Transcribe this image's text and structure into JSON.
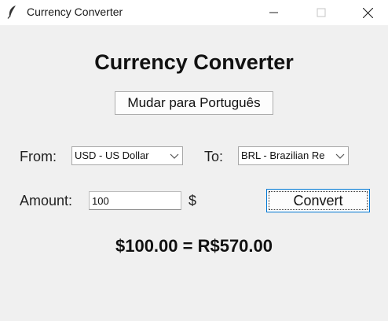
{
  "window": {
    "title": "Currency Converter",
    "icon": "feather-icon"
  },
  "main": {
    "heading": "Currency Converter",
    "language_button": "Mudar para Português",
    "from_label": "From:",
    "from_value": "USD - US Dollar",
    "to_label": "To:",
    "to_value": "BRL - Brazilian Re",
    "amount_label": "Amount:",
    "amount_value": "100",
    "currency_symbol": "$",
    "convert_button": "Convert",
    "result": "$100.00 = R$570.00"
  },
  "colors": {
    "background": "#f0f0f0",
    "titlebar": "#ffffff",
    "focus_border": "#0078d4"
  }
}
